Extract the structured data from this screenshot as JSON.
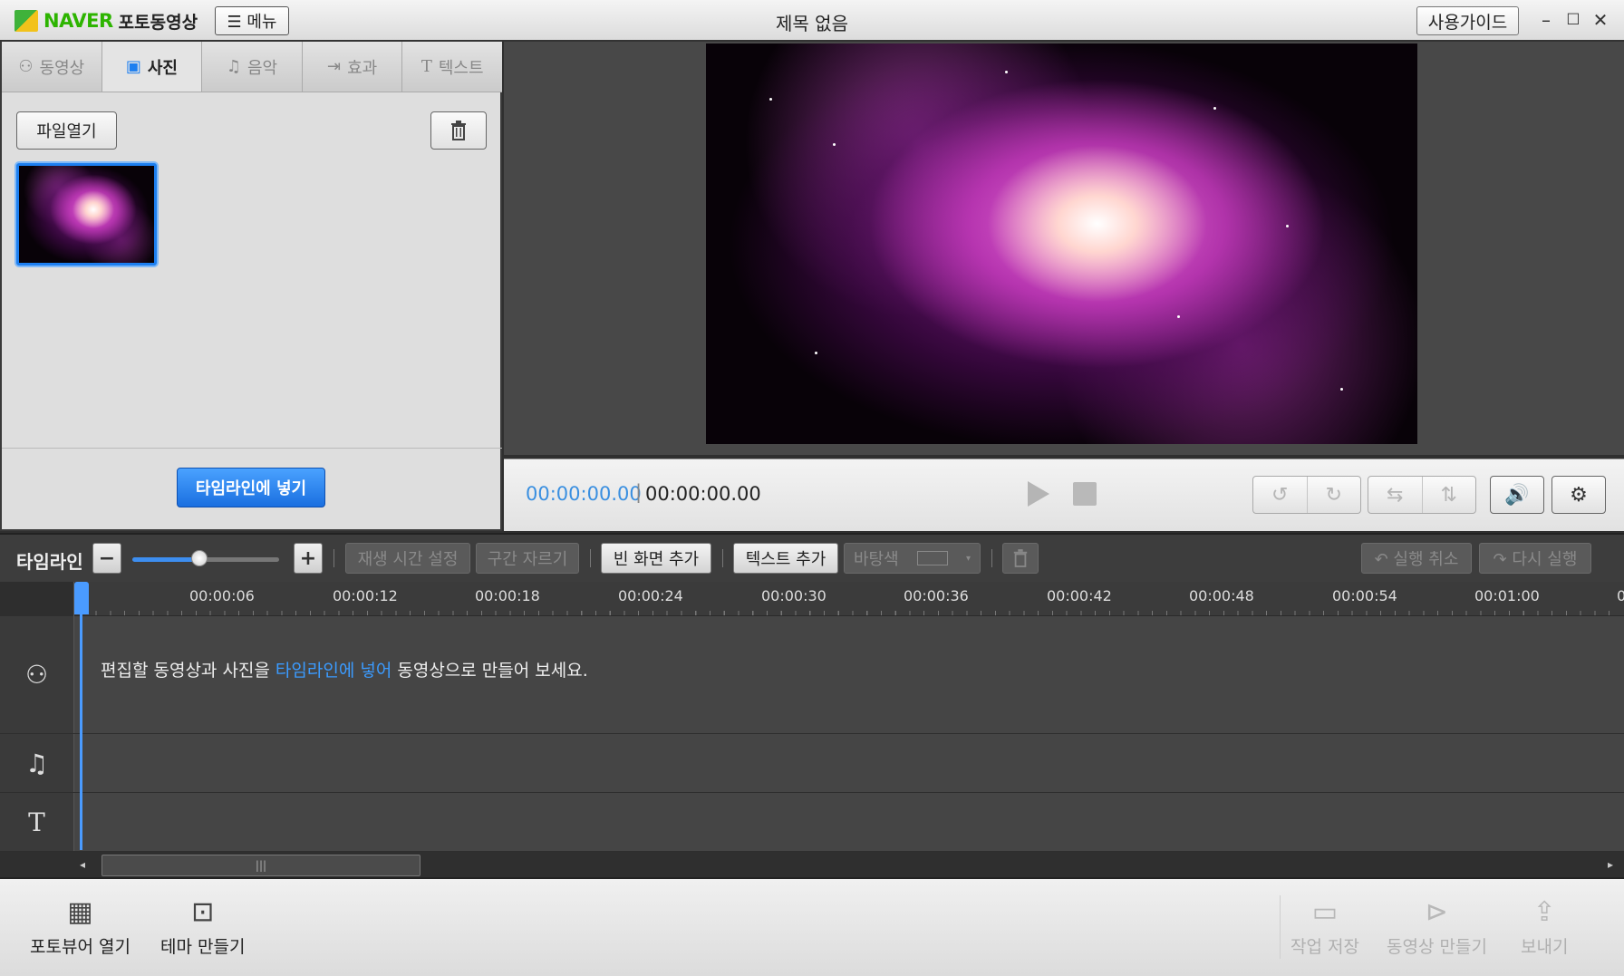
{
  "app": {
    "brand": "NAVER",
    "product": "포토동영상",
    "menu_label": "☰ 메뉴",
    "window_title": "제목 없음",
    "guide_label": "사용가이드",
    "controls": {
      "minimize": "–",
      "maximize": "☐",
      "close": "✕"
    }
  },
  "left_panel": {
    "tabs": [
      {
        "label": "동영상",
        "icon": "people-icon",
        "glyph": "⚇"
      },
      {
        "label": "사진",
        "icon": "photo-icon",
        "glyph": "▣"
      },
      {
        "label": "음악",
        "icon": "music-icon",
        "glyph": "♫"
      },
      {
        "label": "효과",
        "icon": "effect-icon",
        "glyph": "⇥"
      },
      {
        "label": "텍스트",
        "icon": "text-icon",
        "glyph": "T"
      }
    ],
    "active_tab": "사진",
    "open_file_label": "파일열기",
    "put_timeline_label": "타임라인에 넣기"
  },
  "preview": {
    "current_time": "00:00:00.00",
    "separator": "|",
    "total_time": "00:00:00.00"
  },
  "timeline_toolbar": {
    "label": "타임라인",
    "zoom_minus": "−",
    "zoom_plus": "+",
    "zoom_level": 0.45,
    "play_time_label": "재생 시간 설정",
    "cut_label": "구간 자르기",
    "blank_add_label": "빈 화면 추가",
    "text_add_label": "텍스트 추가",
    "bg_color_label": "바탕색",
    "undo_label": "↶ 실행 취소",
    "redo_label": "↷ 다시 실행"
  },
  "ruler": {
    "ticks": [
      "00:00:06",
      "00:00:12",
      "00:00:18",
      "00:00:24",
      "00:00:30",
      "00:00:36",
      "00:00:42",
      "00:00:48",
      "00:00:54",
      "00:01:00",
      "0"
    ]
  },
  "tracks": {
    "video_icon": "⚇",
    "music_icon": "♫",
    "text_icon": "T",
    "message_pre": "편집할 동영상과 사진을 ",
    "message_hl": "타임라인에 넣어",
    "message_post": " 동영상으로 만들어 보세요."
  },
  "scrollbar": {
    "grip": "|||",
    "left": "◂",
    "right": "▸"
  },
  "bottom_bar": {
    "photoviewer_label": "포토뷰어 열기",
    "theme_label": "테마 만들기",
    "save_label": "작업 저장",
    "make_video_label": "동영상 만들기",
    "send_label": "보내기"
  },
  "colors": {
    "accent": "#1d7ff0",
    "brand_green": "#2db400",
    "highlight_text": "#3b9bff"
  }
}
